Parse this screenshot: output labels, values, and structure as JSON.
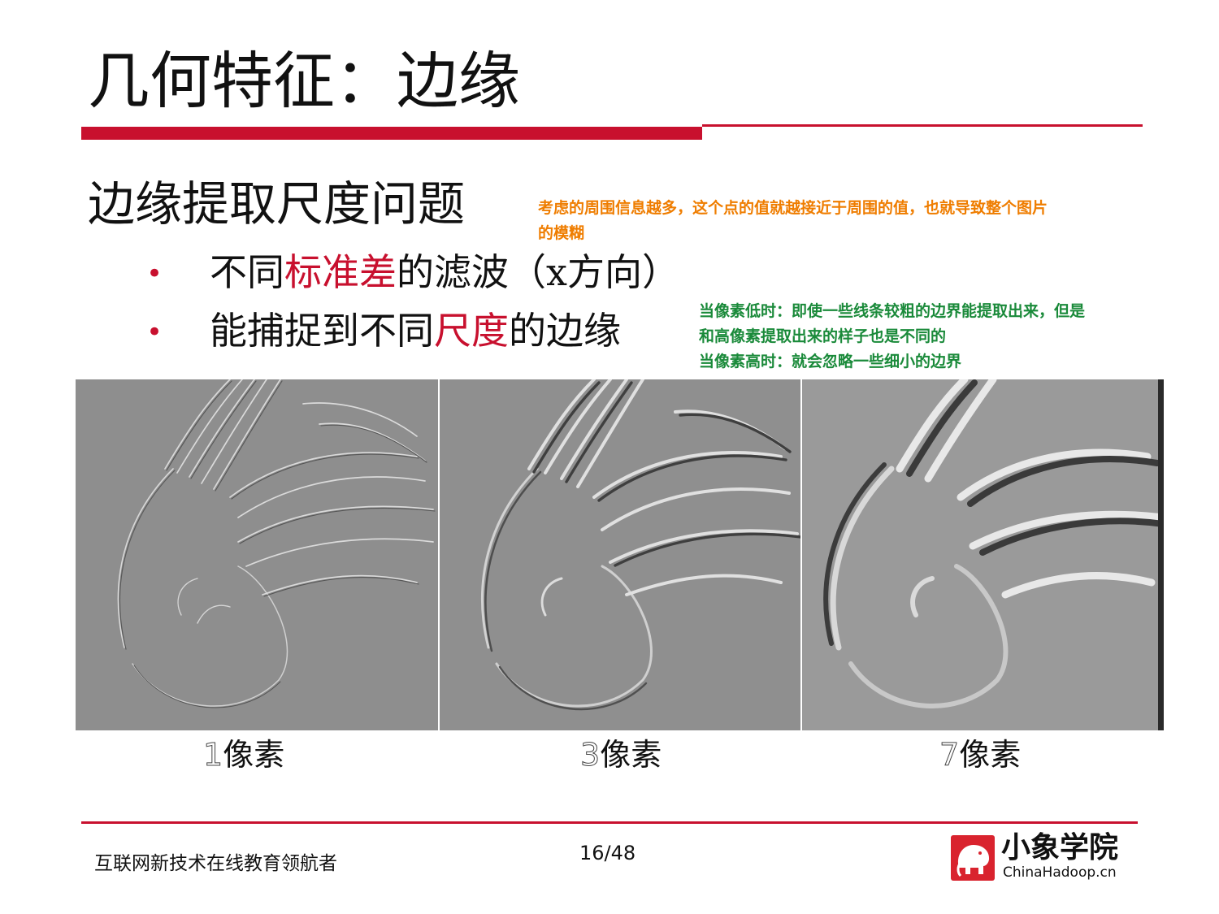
{
  "slide": {
    "title": "几何特征：边缘",
    "subtitle": "边缘提取尺度问题",
    "note_orange": [
      "考虑的周围信息越多，这个点的值就越接近于周围的值，也就导致整个图片",
      "的模糊"
    ],
    "bullets": [
      {
        "before": "不同",
        "highlight": "标准差",
        "after": "的滤波（x方向）"
      },
      {
        "before": "能捕捉到不同",
        "highlight": "尺度",
        "after": "的边缘"
      }
    ],
    "note_green": [
      "当像素低时：即使一些线条较粗的边界能提取出来，但是",
      "和高像素提取出来的样子也是不同的",
      "当像素高时：就会忽略一些细小的边界"
    ],
    "panels": [
      {
        "num": "1",
        "unit": "像素"
      },
      {
        "num": "3",
        "unit": "像素"
      },
      {
        "num": "7",
        "unit": "像素"
      }
    ]
  },
  "footer": {
    "slogan": "互联网新技术在线教育领航者",
    "page": "16/48",
    "logo_name": "小象学院",
    "logo_site": "ChinaHadoop.cn"
  },
  "colors": {
    "accent_red": "#c8102e",
    "note_orange": "#ef7d00",
    "note_green": "#1a8a3a"
  }
}
